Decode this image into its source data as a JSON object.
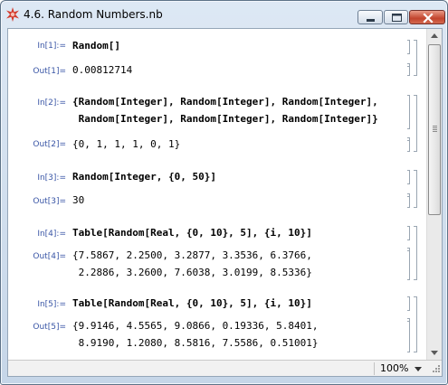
{
  "window": {
    "title": "4.6. Random Numbers.nb",
    "icon": "mathematica-star-icon"
  },
  "cells": [
    {
      "in_label": "In[1]:=",
      "in_lines": [
        "Random[]"
      ],
      "out_label": "Out[1]=",
      "out_lines": [
        "0.00812714"
      ]
    },
    {
      "in_label": "In[2]:=",
      "in_lines": [
        "{Random[Integer], Random[Integer], Random[Integer],",
        " Random[Integer], Random[Integer], Random[Integer]}"
      ],
      "out_label": "Out[2]=",
      "out_lines": [
        "{0, 1, 1, 1, 0, 1}"
      ]
    },
    {
      "in_label": "In[3]:=",
      "in_lines": [
        "Random[Integer, {0, 50}]"
      ],
      "out_label": "Out[3]=",
      "out_lines": [
        "30"
      ]
    },
    {
      "in_label": "In[4]:=",
      "in_lines": [
        "Table[Random[Real, {0, 10}, 5], {i, 10}]"
      ],
      "out_label": "Out[4]=",
      "out_lines": [
        "{7.5867, 2.2500, 3.2877, 3.3536, 6.3766,",
        " 2.2886, 3.2600, 7.6038, 3.0199, 8.5336}"
      ]
    },
    {
      "in_label": "In[5]:=",
      "in_lines": [
        "Table[Random[Real, {0, 10}, 5], {i, 10}]"
      ],
      "out_label": "Out[5]=",
      "out_lines": [
        "{9.9146, 4.5565, 9.0866, 0.19336, 5.8401,",
        " 8.9190, 1.2080, 8.5816, 7.5586, 0.51001}"
      ]
    }
  ],
  "statusbar": {
    "zoom": "100%"
  },
  "colors": {
    "label": "#3a56a6",
    "symbol": "#3a6fa8",
    "bracket": "#9aa6b2",
    "close_button": "#c2442d"
  }
}
